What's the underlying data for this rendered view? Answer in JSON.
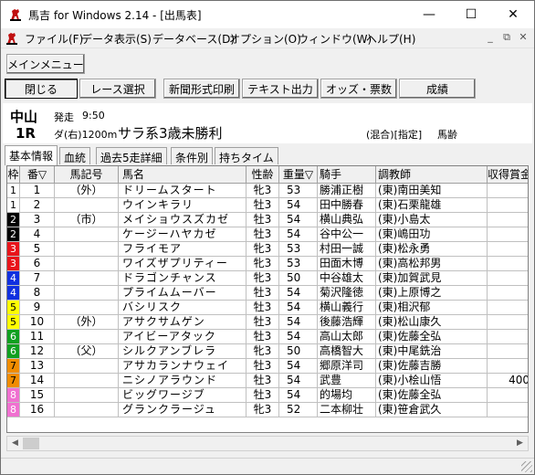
{
  "window": {
    "title": "馬吉 for Windows 2.14 - [出馬表]",
    "minimize_glyph": "—",
    "maximize_glyph": "☐",
    "close_glyph": "✕"
  },
  "menu": {
    "items": [
      "ファイル(F)",
      "データ表示(S)",
      "データベース(D)",
      "オプション(O)",
      "ウィンドウ(W)",
      "ヘルプ(H)"
    ],
    "mdi_minimize": "_",
    "mdi_restore": "⧉",
    "mdi_close": "✕"
  },
  "toolbar": {
    "main_menu": "メインメニュー",
    "close": "閉じる",
    "race_select": "レース選択",
    "newspaper_print": "新聞形式印刷",
    "text_output": "テキスト出力",
    "odds": "オッズ・票数",
    "results": "成績"
  },
  "race": {
    "course": "中山",
    "race_no": "1R",
    "start_label": "発走",
    "start_time": "9:50",
    "track": "ダ(右)1200m",
    "name": "サラ系3歳未勝利",
    "condition": "(混合)[指定]",
    "weight_type": "馬齢"
  },
  "tabs": [
    "基本情報",
    "血統",
    "過去5走詳細",
    "条件別",
    "持ちタイム"
  ],
  "columns": [
    "枠",
    "番▽",
    "馬記号",
    "馬名",
    "性齢",
    "重量▽",
    "騎手",
    "調教師",
    "収得賞金▽"
  ],
  "waku_colors": {
    "1": {
      "bg": "#ffffff",
      "fg": "#000000"
    },
    "2": {
      "bg": "#000000",
      "fg": "#ffffff"
    },
    "3": {
      "bg": "#e8141a",
      "fg": "#ffffff"
    },
    "4": {
      "bg": "#1030e0",
      "fg": "#ffffff"
    },
    "5": {
      "bg": "#ffff00",
      "fg": "#000000"
    },
    "6": {
      "bg": "#10a020",
      "fg": "#ffffff"
    },
    "7": {
      "bg": "#f08c00",
      "fg": "#000000"
    },
    "8": {
      "bg": "#f070d0",
      "fg": "#ffffff"
    }
  },
  "horses": [
    {
      "waku": "1",
      "num": "1",
      "mark": "（外）",
      "name": "ドリームスタート",
      "sex_age": "牝3",
      "weight": "53",
      "jockey": "勝浦正樹",
      "trainer": "(東)南田美知",
      "prize": ""
    },
    {
      "waku": "1",
      "num": "2",
      "mark": "",
      "name": "ウインキラリ",
      "sex_age": "牡3",
      "weight": "54",
      "jockey": "田中勝春",
      "trainer": "(東)石栗龍雄",
      "prize": ""
    },
    {
      "waku": "2",
      "num": "3",
      "mark": "（市）",
      "name": "メイショウスズカゼ",
      "sex_age": "牡3",
      "weight": "54",
      "jockey": "横山典弘",
      "trainer": "(東)小島太",
      "prize": ""
    },
    {
      "waku": "2",
      "num": "4",
      "mark": "",
      "name": "ケージーハヤカゼ",
      "sex_age": "牡3",
      "weight": "54",
      "jockey": "谷中公一",
      "trainer": "(東)嶋田功",
      "prize": ""
    },
    {
      "waku": "3",
      "num": "5",
      "mark": "",
      "name": "フライモア",
      "sex_age": "牝3",
      "weight": "53",
      "jockey": "村田一誠",
      "trainer": "(東)松永勇",
      "prize": ""
    },
    {
      "waku": "3",
      "num": "6",
      "mark": "",
      "name": "ワイズザプリティー",
      "sex_age": "牝3",
      "weight": "53",
      "jockey": "田面木博",
      "trainer": "(東)高松邦男",
      "prize": ""
    },
    {
      "waku": "4",
      "num": "7",
      "mark": "",
      "name": "ドラゴンチャンス",
      "sex_age": "牝3",
      "weight": "50",
      "jockey": "中谷雄太",
      "trainer": "(東)加賀武見",
      "prize": ""
    },
    {
      "waku": "4",
      "num": "8",
      "mark": "",
      "name": "プライムムーバー",
      "sex_age": "牡3",
      "weight": "54",
      "jockey": "菊沢隆徳",
      "trainer": "(東)上原博之",
      "prize": ""
    },
    {
      "waku": "5",
      "num": "9",
      "mark": "",
      "name": "バシリスク",
      "sex_age": "牡3",
      "weight": "54",
      "jockey": "横山義行",
      "trainer": "(東)相沢郁",
      "prize": ""
    },
    {
      "waku": "5",
      "num": "10",
      "mark": "（外）",
      "name": "アサクサムゲン",
      "sex_age": "牡3",
      "weight": "54",
      "jockey": "後藤浩輝",
      "trainer": "(東)松山康久",
      "prize": ""
    },
    {
      "waku": "6",
      "num": "11",
      "mark": "",
      "name": "アイビーアタック",
      "sex_age": "牡3",
      "weight": "54",
      "jockey": "高山太郎",
      "trainer": "(東)佐藤全弘",
      "prize": ""
    },
    {
      "waku": "6",
      "num": "12",
      "mark": "（父）",
      "name": "シルクアンブレラ",
      "sex_age": "牝3",
      "weight": "50",
      "jockey": "高橋智大",
      "trainer": "(東)中尾銑治",
      "prize": ""
    },
    {
      "waku": "7",
      "num": "13",
      "mark": "",
      "name": "アサカランナウェイ",
      "sex_age": "牡3",
      "weight": "54",
      "jockey": "郷原洋司",
      "trainer": "(東)佐藤吉勝",
      "prize": ""
    },
    {
      "waku": "7",
      "num": "14",
      "mark": "",
      "name": "ニシノアラウンド",
      "sex_age": "牡3",
      "weight": "54",
      "jockey": "武豊",
      "trainer": "(東)小桧山悟",
      "prize": "400"
    },
    {
      "waku": "8",
      "num": "15",
      "mark": "",
      "name": "ビッグワージブ",
      "sex_age": "牡3",
      "weight": "54",
      "jockey": "的場均",
      "trainer": "(東)佐藤全弘",
      "prize": ""
    },
    {
      "waku": "8",
      "num": "16",
      "mark": "",
      "name": "グランクラージュ",
      "sex_age": "牝3",
      "weight": "52",
      "jockey": "二本柳壮",
      "trainer": "(東)笹倉武久",
      "prize": ""
    }
  ],
  "icons": {
    "app": "horse-icon",
    "scroll_left": "◀",
    "scroll_right": "▶"
  }
}
